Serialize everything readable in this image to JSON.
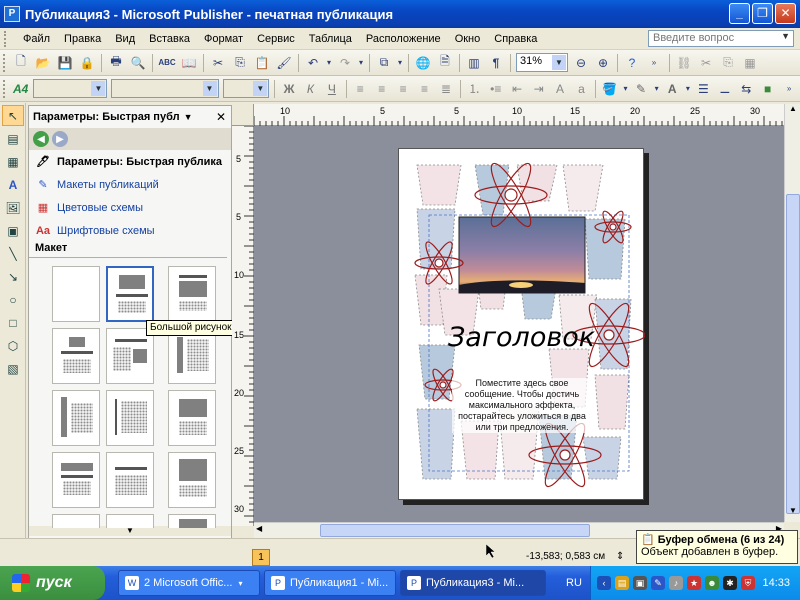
{
  "window": {
    "title": "Публикация3 - Microsoft Publisher - печатная публикация",
    "minimize": "_",
    "maximize": "❐",
    "close": "✕"
  },
  "menu": {
    "items": [
      "Файл",
      "Правка",
      "Вид",
      "Вставка",
      "Формат",
      "Сервис",
      "Таблица",
      "Расположение",
      "Окно",
      "Справка"
    ],
    "help_placeholder": "Введите вопрос"
  },
  "toolbar": {
    "zoom_value": "31%"
  },
  "format_toolbar": {
    "bold": "Ж",
    "italic": "К",
    "underline": "Ч"
  },
  "taskpane": {
    "title": "Параметры: Быстрая публ",
    "rows": [
      {
        "label": "Параметры: Быстрая публика",
        "active": true
      },
      {
        "label": "Макеты публикаций",
        "active": false
      },
      {
        "label": "Цветовые схемы",
        "active": false
      },
      {
        "label": "Шрифтовые схемы",
        "active": false
      }
    ],
    "section": "Макет",
    "tooltip": "Большой рисунок вверху"
  },
  "ruler": {
    "h_ticks": [
      "10",
      "5",
      "5",
      "10",
      "15",
      "20",
      "25",
      "30"
    ],
    "v_ticks": [
      "5",
      "5",
      "10",
      "15",
      "20",
      "25",
      "30"
    ]
  },
  "document": {
    "headline": "Заголовок",
    "body": "Поместите здесь свое сообщение. Чтобы достичь максимального эффекта, постарайтесь уложиться в два или три предложения."
  },
  "status": {
    "page_number": "1",
    "coords": "-13,583; 0,583 см"
  },
  "clipboard": {
    "title": "Буфер обмена (6 из 24)",
    "message": "Объект добавлен в буфер."
  },
  "taskbar": {
    "start": "пуск",
    "tasks": [
      {
        "label": "2 Microsoft Offic...",
        "icon": "W"
      },
      {
        "label": "Публикация1 - Mi...",
        "icon": "P"
      },
      {
        "label": "Публикация3 - Mi...",
        "icon": "P"
      }
    ],
    "lang": "RU",
    "clock": "14:33"
  },
  "colors": {
    "title_blue": "#0846c2",
    "task_active": "#1e47a8",
    "tray": "#0c8bea",
    "accent_red": "#9c1c1c"
  }
}
